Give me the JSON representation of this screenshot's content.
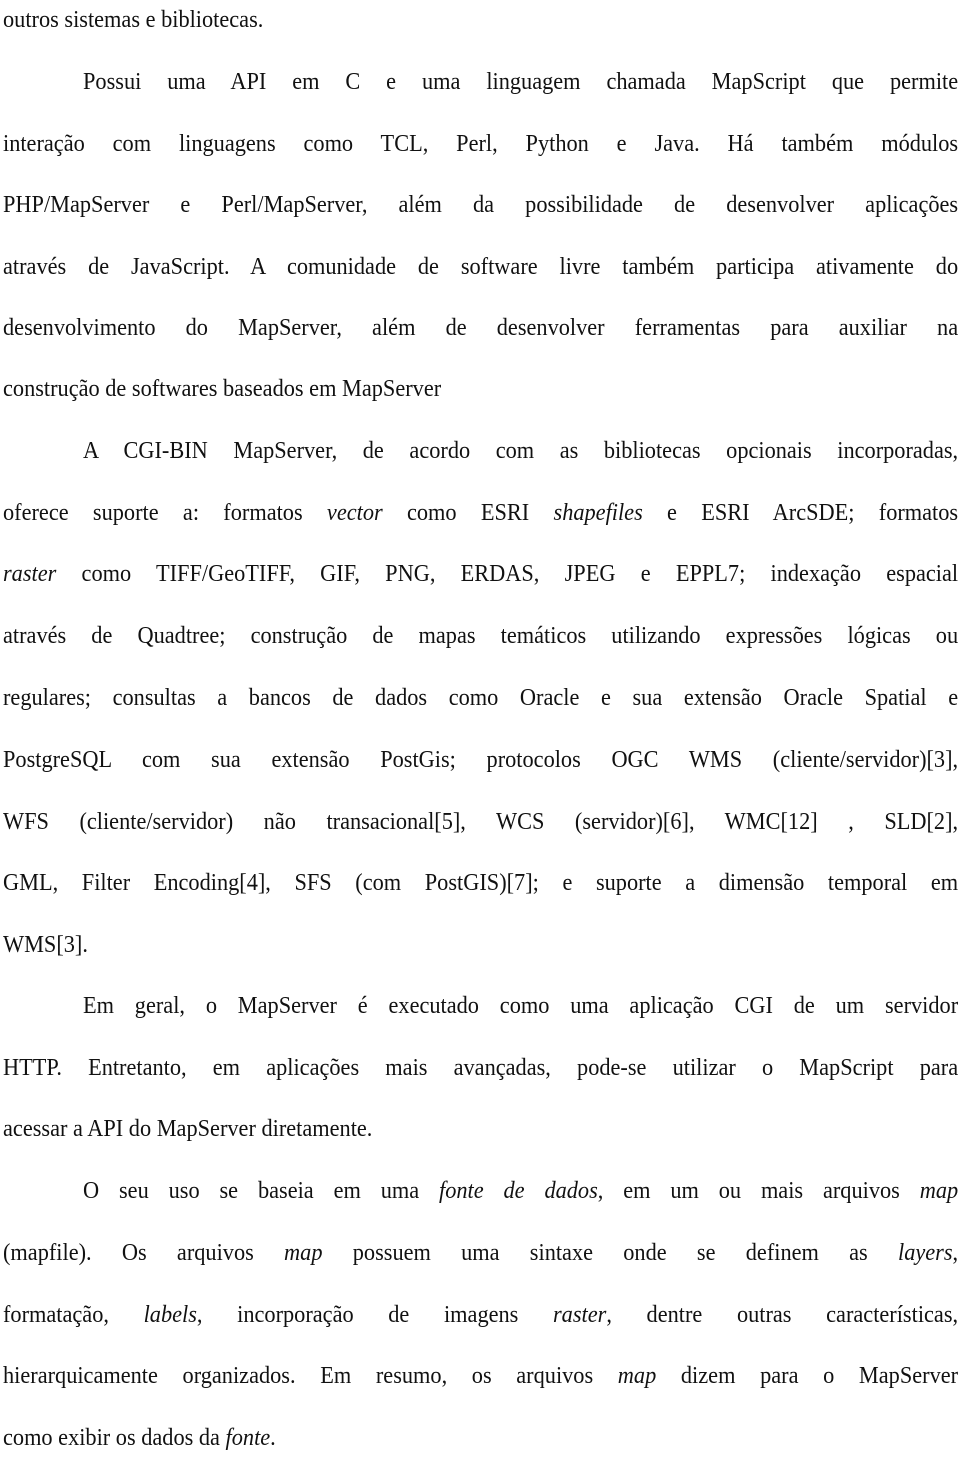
{
  "document": {
    "language": "pt-BR",
    "lines": [
      {
        "segments": [
          {
            "text": "outros sistemas e bibliotecas."
          }
        ]
      },
      {
        "segments": [
          {
            "text": "Possui uma API em C e uma linguagem chamada MapScript que permite"
          }
        ]
      },
      {
        "segments": [
          {
            "text": "interação com linguagens como TCL, Perl, Python e Java. Há também módulos"
          }
        ]
      },
      {
        "segments": [
          {
            "text": "PHP/MapServer e Perl/MapServer, além da possibilidade de desenvolver aplicações"
          }
        ]
      },
      {
        "segments": [
          {
            "text": "através de JavaScript. A comunidade de software livre também participa ativamente do"
          }
        ]
      },
      {
        "segments": [
          {
            "text": "desenvolvimento do MapServer, além de desenvolver ferramentas para auxiliar na"
          }
        ]
      },
      {
        "segments": [
          {
            "text": "construção de softwares baseados em MapServer"
          }
        ]
      },
      {
        "segments": [
          {
            "text": "A CGI-BIN MapServer, de acordo com as bibliotecas opcionais incorporadas,"
          }
        ]
      },
      {
        "segments": [
          {
            "text": "oferece suporte a: formatos "
          },
          {
            "text": "vector",
            "italic": true
          },
          {
            "text": " como ESRI "
          },
          {
            "text": "shapefiles",
            "italic": true
          },
          {
            "text": " e ESRI ArcSDE; formatos"
          }
        ]
      },
      {
        "segments": [
          {
            "text": "raster",
            "italic": true
          },
          {
            "text": " como TIFF/GeoTIFF, GIF, PNG, ERDAS, JPEG e EPPL7; indexação espacial"
          }
        ]
      },
      {
        "segments": [
          {
            "text": "através de Quadtree; construção de mapas temáticos utilizando expressões lógicas ou"
          }
        ]
      },
      {
        "segments": [
          {
            "text": "regulares; consultas a bancos de dados como Oracle e sua extensão Oracle Spatial e"
          }
        ]
      },
      {
        "segments": [
          {
            "text": "PostgreSQL com sua extensão PostGis; protocolos OGC WMS (cliente/servidor)[3],"
          }
        ]
      },
      {
        "segments": [
          {
            "text": "WFS (cliente/servidor) não transacional[5], WCS (servidor)[6], WMC[12] , SLD[2],"
          }
        ]
      },
      {
        "segments": [
          {
            "text": "GML, Filter Encoding[4], SFS (com PostGIS)[7]; e suporte a dimensão temporal em"
          }
        ]
      },
      {
        "segments": [
          {
            "text": "WMS[3]."
          }
        ]
      },
      {
        "segments": [
          {
            "text": "Em geral, o MapServer é executado como uma aplicação CGI de um servidor"
          }
        ]
      },
      {
        "segments": [
          {
            "text": "HTTP. Entretanto, em aplicações mais avançadas, pode-se utilizar o MapScript para"
          }
        ]
      },
      {
        "segments": [
          {
            "text": "acessar a API do MapServer diretamente."
          }
        ]
      },
      {
        "segments": [
          {
            "text": "O seu uso se baseia em uma "
          },
          {
            "text": "fonte de dados",
            "italic": true
          },
          {
            "text": ", em um ou mais arquivos "
          },
          {
            "text": "map",
            "italic": true
          }
        ]
      },
      {
        "segments": [
          {
            "text": "(mapfile). Os arquivos "
          },
          {
            "text": "map",
            "italic": true
          },
          {
            "text": " possuem uma sintaxe onde se definem as "
          },
          {
            "text": "layers",
            "italic": true
          },
          {
            "text": ","
          }
        ]
      },
      {
        "segments": [
          {
            "text": "formatação, "
          },
          {
            "text": "labels",
            "italic": true
          },
          {
            "text": ", incorporação de imagens "
          },
          {
            "text": "raster",
            "italic": true
          },
          {
            "text": ", dentre outras características,"
          }
        ]
      },
      {
        "segments": [
          {
            "text": "hierarquicamente organizados. Em resumo, os arquivos "
          },
          {
            "text": "map",
            "italic": true
          },
          {
            "text": " dizem para o MapServer"
          }
        ]
      },
      {
        "segments": [
          {
            "text": "como exibir os dados da "
          },
          {
            "text": "fonte",
            "italic": true
          },
          {
            "text": "."
          }
        ]
      }
    ]
  }
}
